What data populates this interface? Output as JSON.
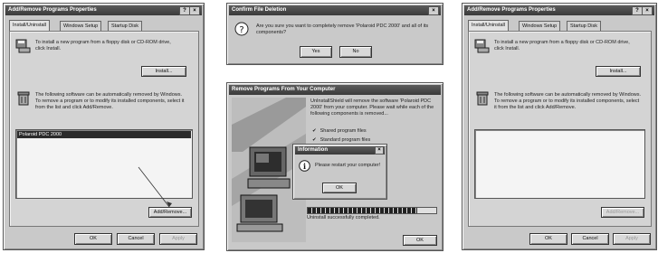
{
  "colors": {
    "dialog": "#c9c9c9",
    "titlebar": "#444444",
    "selection": "#2c2c2c"
  },
  "panel1": {
    "title": "Add/Remove Programs Properties",
    "close_label": "?|X",
    "tabs": [
      "Install/Uninstall",
      "Windows Setup",
      "Startup Disk"
    ],
    "install_text": "To install a new program from a floppy disk or CD-ROM drive, click Install.",
    "install_button": "Install...",
    "remove_text": "The following software can be automatically removed by Windows. To remove a program or to modify its installed components, select it from the list and click Add/Remove.",
    "list_items": [
      "Polaroid PDC 2000"
    ],
    "addremove_button": "Add/Remove...",
    "ok_button": "OK",
    "cancel_button": "Cancel",
    "apply_button": "Apply"
  },
  "panel2": {
    "title": "Confirm File Deletion",
    "close_label": "X",
    "question_icon": "question-icon",
    "message": "Are you sure you want to completely remove 'Polaroid PDC 2000' and all of its components?",
    "yes_button": "Yes",
    "no_button": "No"
  },
  "panel3": {
    "title": "Remove Programs From Your Computer",
    "intro": "UnInstallShield will remove the software 'Polaroid PDC 2000' from your computer. Please wait while each of the following components is removed...",
    "steps": [
      "Shared program files",
      "Standard program files"
    ],
    "info_dialog": {
      "title": "Information",
      "message": "Please restart your computer!",
      "ok_button": "OK",
      "close_label": "X"
    },
    "progress": 0.85,
    "status": "Uninstall successfully completed.",
    "ok_button": "OK"
  },
  "panel4": {
    "title": "Add/Remove Programs Properties",
    "close_label": "?|X",
    "tabs": [
      "Install/Uninstall",
      "Windows Setup",
      "Startup Disk"
    ],
    "install_text": "To install a new program from a floppy disk or CD-ROM drive, click Install.",
    "install_button": "Install...",
    "remove_text": "The following software can be automatically removed by Windows. To remove a program or to modify its installed components, select it from the list and click Add/Remove.",
    "addremove_button": "Add/Remove...",
    "ok_button": "OK",
    "cancel_button": "Cancel",
    "apply_button": "Apply"
  }
}
